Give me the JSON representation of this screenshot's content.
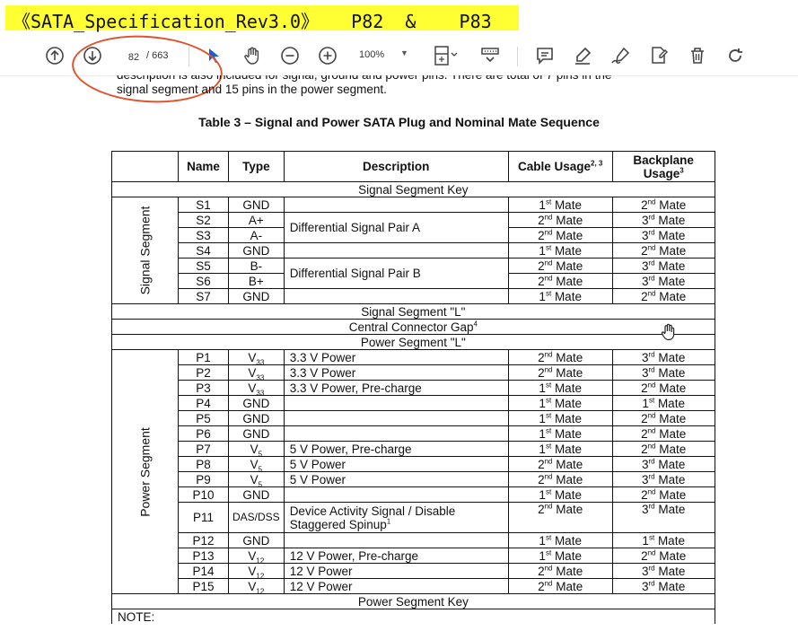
{
  "banner": {
    "text": "《SATA_Specification_Rev3.0》   P82  &    P83"
  },
  "toolbar": {
    "page_current": "82",
    "page_total": "/ 663",
    "zoom": "100%"
  },
  "doc": {
    "intro_line1": "description is also included for signal, ground and power pins.  There are total of 7 pins in the",
    "intro_line2": "signal segment and 15 pins in the power segment.",
    "table_title": "Table 3 – Signal and Power SATA Plug and Nominal Mate Sequence"
  },
  "table": {
    "headers": {
      "name": "Name",
      "type": "Type",
      "description": "Description",
      "cable": "Cable Usage",
      "cable_sup": "2, 3",
      "backplane1": "Backplane",
      "backplane2": "Usage",
      "backplane_sup": "3"
    },
    "signal_key": "Signal Segment Key",
    "signal_group": "Signal Segment",
    "signal_rows": [
      {
        "name": "S1",
        "type": "GND",
        "cable_n": "1",
        "cable_s": "st",
        "bp_n": "2",
        "bp_s": "nd"
      },
      {
        "name": "S2",
        "type": "A+",
        "cable_n": "2",
        "cable_s": "nd",
        "bp_n": "3",
        "bp_s": "rd"
      },
      {
        "name": "S3",
        "type": "A-",
        "cable_n": "2",
        "cable_s": "nd",
        "bp_n": "3",
        "bp_s": "rd"
      },
      {
        "name": "S4",
        "type": "GND",
        "cable_n": "1",
        "cable_s": "st",
        "bp_n": "2",
        "bp_s": "nd"
      },
      {
        "name": "S5",
        "type": "B-",
        "cable_n": "2",
        "cable_s": "nd",
        "bp_n": "3",
        "bp_s": "rd"
      },
      {
        "name": "S6",
        "type": "B+",
        "cable_n": "2",
        "cable_s": "nd",
        "bp_n": "3",
        "bp_s": "rd"
      },
      {
        "name": "S7",
        "type": "GND",
        "cable_n": "1",
        "cable_s": "st",
        "bp_n": "2",
        "bp_s": "nd"
      }
    ],
    "pair_a": "Differential Signal Pair A",
    "pair_b": "Differential Signal Pair B",
    "signal_l": "Signal Segment \"L\"",
    "gap": "Central Connector Gap",
    "gap_sup": "4",
    "power_l": "Power Segment \"L\"",
    "power_group": "Power Segment",
    "power_rows": [
      {
        "name": "P1",
        "type": "V",
        "type_sub": "33",
        "desc": "3.3 V Power",
        "cable_n": "2",
        "cable_s": "nd",
        "bp_n": "3",
        "bp_s": "rd"
      },
      {
        "name": "P2",
        "type": "V",
        "type_sub": "33",
        "desc": "3.3 V Power",
        "cable_n": "2",
        "cable_s": "nd",
        "bp_n": "3",
        "bp_s": "rd"
      },
      {
        "name": "P3",
        "type": "V",
        "type_sub": "33",
        "desc": "3.3 V Power, Pre-charge",
        "cable_n": "1",
        "cable_s": "st",
        "bp_n": "2",
        "bp_s": "nd"
      },
      {
        "name": "P4",
        "type": "GND",
        "type_sub": "",
        "desc": "",
        "cable_n": "1",
        "cable_s": "st",
        "bp_n": "1",
        "bp_s": "st"
      },
      {
        "name": "P5",
        "type": "GND",
        "type_sub": "",
        "desc": "",
        "cable_n": "1",
        "cable_s": "st",
        "bp_n": "2",
        "bp_s": "nd"
      },
      {
        "name": "P6",
        "type": "GND",
        "type_sub": "",
        "desc": "",
        "cable_n": "1",
        "cable_s": "st",
        "bp_n": "2",
        "bp_s": "nd"
      },
      {
        "name": "P7",
        "type": "V",
        "type_sub": "5",
        "desc": "5 V Power, Pre-charge",
        "cable_n": "1",
        "cable_s": "st",
        "bp_n": "2",
        "bp_s": "nd"
      },
      {
        "name": "P8",
        "type": "V",
        "type_sub": "5",
        "desc": "5 V Power",
        "cable_n": "2",
        "cable_s": "nd",
        "bp_n": "3",
        "bp_s": "rd"
      },
      {
        "name": "P9",
        "type": "V",
        "type_sub": "5",
        "desc": "5 V Power",
        "cable_n": "2",
        "cable_s": "nd",
        "bp_n": "3",
        "bp_s": "rd"
      },
      {
        "name": "P10",
        "type": "GND",
        "type_sub": "",
        "desc": "",
        "cable_n": "1",
        "cable_s": "st",
        "bp_n": "2",
        "bp_s": "nd"
      },
      {
        "name": "P11",
        "type": "DAS/DSS",
        "type_sub": "",
        "desc": "Device Activity Signal / Disable",
        "desc2": "Staggered Spinup",
        "desc2_sup": "1",
        "cable_n": "2",
        "cable_s": "nd",
        "bp_n": "3",
        "bp_s": "rd"
      },
      {
        "name": "P12",
        "type": "GND",
        "type_sub": "",
        "desc": "",
        "cable_n": "1",
        "cable_s": "st",
        "bp_n": "1",
        "bp_s": "st"
      },
      {
        "name": "P13",
        "type": "V",
        "type_sub": "12",
        "desc": "12 V Power, Pre-charge",
        "cable_n": "1",
        "cable_s": "st",
        "bp_n": "2",
        "bp_s": "nd"
      },
      {
        "name": "P14",
        "type": "V",
        "type_sub": "12",
        "desc": "12 V Power",
        "cable_n": "2",
        "cable_s": "nd",
        "bp_n": "3",
        "bp_s": "rd"
      },
      {
        "name": "P15",
        "type": "V",
        "type_sub": "12",
        "desc": "12 V Power",
        "cable_n": "2",
        "cable_s": "nd",
        "bp_n": "3",
        "bp_s": "rd"
      }
    ],
    "mate_word": "Mate",
    "power_key": "Power Segment Key",
    "note": "NOTE:"
  },
  "colors": {
    "banner": "#ffff33",
    "annotation_circle": "#e0522d",
    "cursor": "#1a5fd0"
  },
  "icons": [
    "page-up-icon",
    "page-down-icon",
    "select-cursor-icon",
    "hand-tool-icon",
    "zoom-out-icon",
    "zoom-in-icon",
    "fit-page-icon",
    "scroll-mode-icon",
    "comment-icon",
    "highlight-icon",
    "sign-icon",
    "fill-sign-icon",
    "delete-icon",
    "rotate-icon"
  ]
}
